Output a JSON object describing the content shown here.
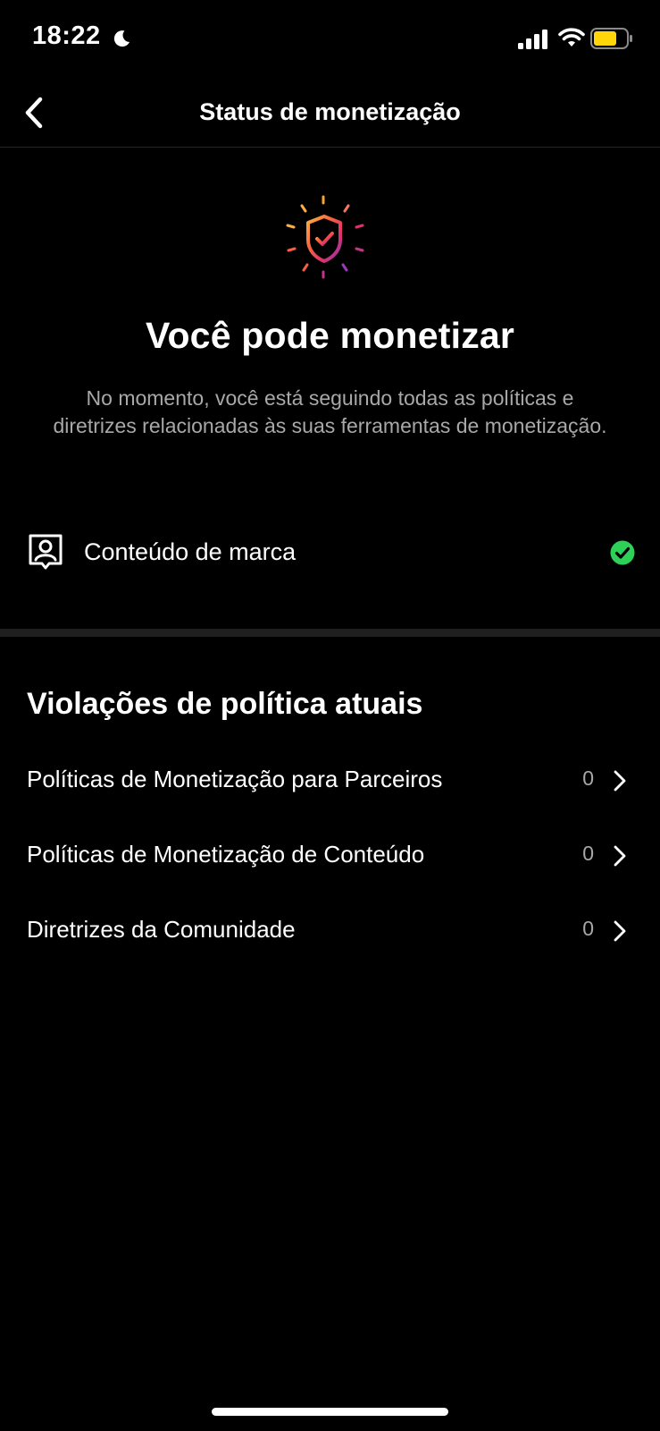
{
  "status_bar": {
    "time": "18:22",
    "moon_icon": "moon-icon",
    "signal_icon": "cellular-signal-icon",
    "wifi_icon": "wifi-icon",
    "battery_icon": "battery-icon",
    "battery_color": "#FFD60A"
  },
  "nav": {
    "back_icon": "chevron-left-icon",
    "title": "Status de monetização"
  },
  "hero": {
    "icon": "shield-check-icon",
    "title": "Você pode monetizar",
    "description": "No momento, você está seguindo todas as políticas e diretrizes relacionadas às suas ferramentas de monetização."
  },
  "branded_content": {
    "icon": "branded-content-icon",
    "label": "Conteúdo de marca",
    "status_icon": "check-circle-icon",
    "status_color": "#2ED158"
  },
  "violations": {
    "title": "Violações de política atuais",
    "items": [
      {
        "label": "Políticas de Monetização para Parceiros",
        "count": "0"
      },
      {
        "label": "Políticas de Monetização de Conteúdo",
        "count": "0"
      },
      {
        "label": "Diretrizes da Comunidade",
        "count": "0"
      }
    ]
  },
  "colors": {
    "background": "#000000",
    "text_primary": "#FFFFFF",
    "text_secondary": "#A8A8A8"
  }
}
